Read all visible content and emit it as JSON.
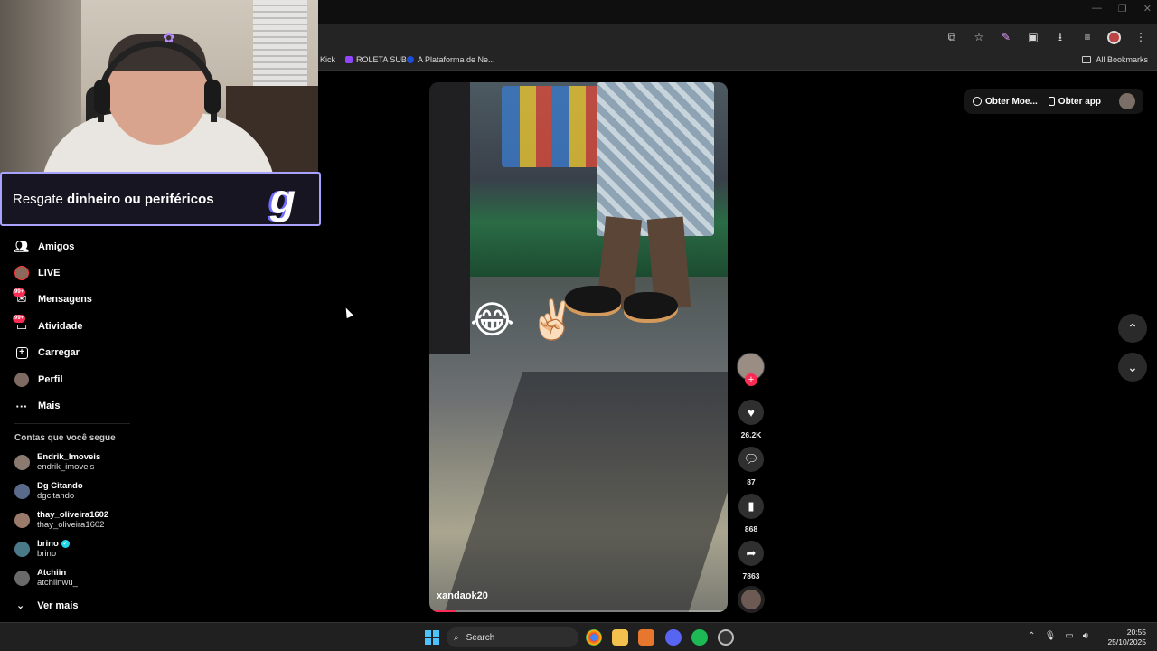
{
  "browser": {
    "bookmarks": [
      {
        "label": "Kick",
        "color": "#53fc18"
      },
      {
        "label": "ROLETA SUB",
        "color": "#9146ff"
      },
      {
        "label": "A Plataforma de Ne...",
        "color": "#1d4ed8"
      }
    ],
    "all_bookmarks_label": "All Bookmarks"
  },
  "stream_overlay": {
    "promo_prefix": "Resgate ",
    "promo_bold": "dinheiro ou periféricos",
    "promo_logo": "g"
  },
  "sidebar": {
    "items": [
      {
        "label": "Amigos",
        "icon": "friends-icon"
      },
      {
        "label": "LIVE",
        "icon": "live-avatar-icon"
      },
      {
        "label": "Mensagens",
        "icon": "messages-icon",
        "badge": "99+"
      },
      {
        "label": "Atividade",
        "icon": "activity-icon",
        "badge": "99+"
      },
      {
        "label": "Carregar",
        "icon": "upload-icon"
      },
      {
        "label": "Perfil",
        "icon": "profile-avatar-icon"
      },
      {
        "label": "Mais",
        "icon": "more-icon"
      }
    ],
    "following_title": "Contas que você segue",
    "following": [
      {
        "name": "Endrik_Imoveis",
        "handle": "endrik_imoveis",
        "verified": false
      },
      {
        "name": "Dg Citando",
        "handle": "dgcitando",
        "verified": false
      },
      {
        "name": "thay_oliveira1602",
        "handle": "thay_oliveira1602",
        "verified": false
      },
      {
        "name": "brino",
        "handle": "brino",
        "verified": true
      },
      {
        "name": "Atchiin",
        "handle": "atchiinwu_",
        "verified": false
      }
    ],
    "see_more": "Ver mais"
  },
  "video": {
    "username": "xandaok20",
    "emojis": [
      "😂",
      "✌🏻"
    ],
    "progress": 0.09
  },
  "actions": {
    "likes": "26.2K",
    "comments": "87",
    "saves": "868",
    "shares": "7863"
  },
  "top_right": {
    "coins_label": "Obter Moe...",
    "app_label": "Obter app"
  },
  "taskbar": {
    "search_placeholder": "Search",
    "time": "20:55",
    "date": "25/10/2025"
  },
  "colors": {
    "accent": "#fe2c55",
    "promo_border": "#a9a2ff",
    "verified": "#20d5ec"
  }
}
